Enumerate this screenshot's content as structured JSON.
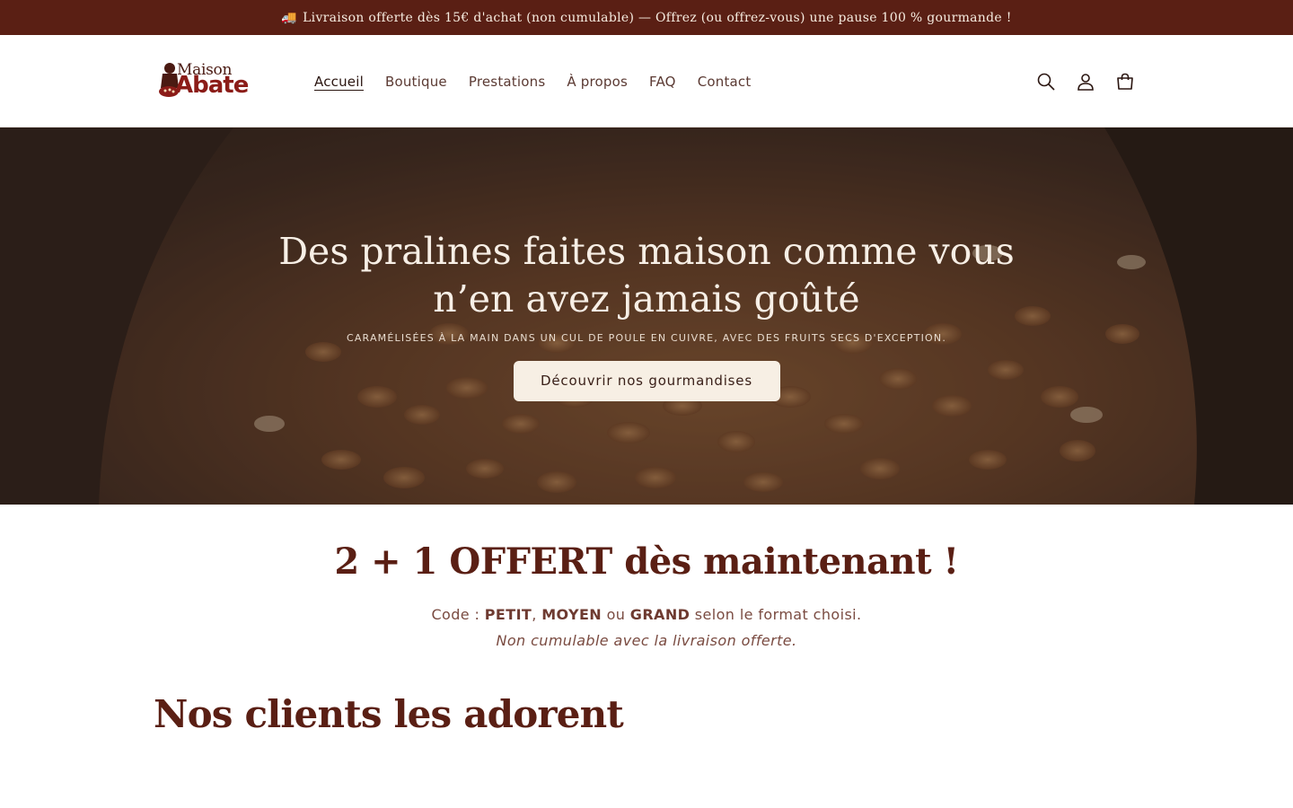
{
  "announcement": {
    "icon": "truck-icon",
    "text": "Livraison offerte dès 15€ d'achat (non cumulable) — Offrez (ou offrez-vous) une pause 100 % gourmande !"
  },
  "header": {
    "logo": {
      "line1": "Maison",
      "line2": "Abate"
    },
    "nav": [
      {
        "label": "Accueil",
        "active": true
      },
      {
        "label": "Boutique"
      },
      {
        "label": "Prestations"
      },
      {
        "label": "À propos"
      },
      {
        "label": "FAQ"
      },
      {
        "label": "Contact"
      }
    ],
    "icons": [
      "search-icon",
      "account-icon",
      "cart-icon"
    ]
  },
  "hero": {
    "title": "Des pralines faites maison comme vous n’en avez jamais goûté",
    "subtitle": "CARAMÉLISÉES À LA MAIN DANS UN CUL DE POULE EN CUIVRE, AVEC DES FRUITS SECS D'EXCEPTION.",
    "cta": "Découvrir nos gourmandises"
  },
  "promo": {
    "title": "2 + 1 OFFERT dès maintenant !",
    "code_prefix": "Code : ",
    "code1": "PETIT",
    "sep1": ", ",
    "code2": "MOYEN",
    "sep2": " ou ",
    "code3": "GRAND",
    "code_suffix": " selon le format choisi.",
    "note": "Non cumulable avec la livraison offerte."
  },
  "reviews": {
    "title": "Nos clients les adorent"
  },
  "colors": {
    "brand": "#5a1f14",
    "accent": "#8b1c18",
    "cta_bg": "#f7efe4"
  }
}
